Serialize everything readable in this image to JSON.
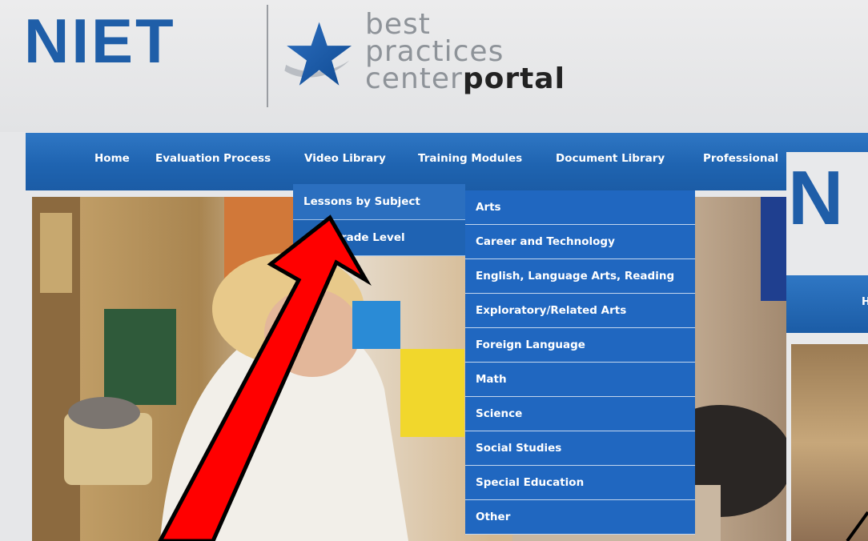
{
  "logo": {
    "brand": "NIET",
    "line1": "best",
    "line2": "practices",
    "line3_prefix": "center",
    "line3_bold": "portal"
  },
  "nav": {
    "items": [
      {
        "label": "Home"
      },
      {
        "label": "Evaluation Process"
      },
      {
        "label": "Video Library"
      },
      {
        "label": "Training Modules"
      },
      {
        "label": "Document Library"
      },
      {
        "label": "Professional"
      }
    ]
  },
  "video_library_submenu": {
    "items": [
      {
        "label": "Lessons by Subject"
      },
      {
        "label": "s by Grade Level"
      }
    ]
  },
  "subject_flyout": {
    "items": [
      {
        "label": "Arts"
      },
      {
        "label": "Career and Technology"
      },
      {
        "label": "English, Language Arts, Reading"
      },
      {
        "label": "Exploratory/Related Arts"
      },
      {
        "label": "Foreign Language"
      },
      {
        "label": "Math"
      },
      {
        "label": "Science"
      },
      {
        "label": "Social Studies"
      },
      {
        "label": "Special Education"
      },
      {
        "label": "Other"
      }
    ]
  },
  "overlay": {
    "logo_fragment": "N",
    "nav_fragment": "H"
  },
  "colors": {
    "brand_blue": "#1f5ea8",
    "nav_blue": "#1f64b1",
    "annotation_arrow": "#ff0000"
  }
}
